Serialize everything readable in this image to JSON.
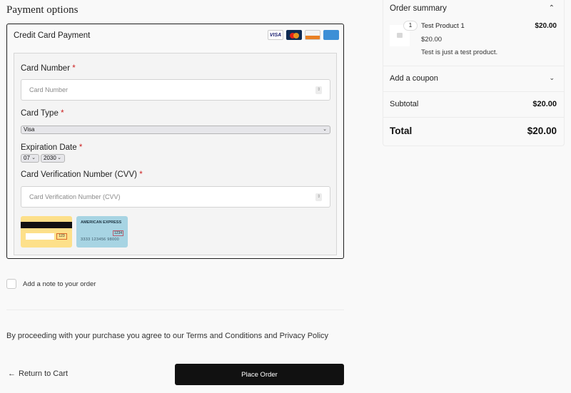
{
  "payment": {
    "section_title": "Payment options",
    "method_label": "Credit Card Payment",
    "card_logos": [
      {
        "name": "visa",
        "text": "VISA"
      },
      {
        "name": "mastercard",
        "text": ""
      },
      {
        "name": "discover",
        "text": "DISCOVER"
      },
      {
        "name": "amex",
        "text": "AMERICAN EXPRESS"
      }
    ],
    "fields": {
      "card_number": {
        "label": "Card Number",
        "required": "*",
        "placeholder": "Card Number"
      },
      "card_type": {
        "label": "Card Type",
        "required": "*",
        "selected": "Visa"
      },
      "expiration": {
        "label": "Expiration Date",
        "required": "*",
        "month": "07",
        "year": "2030"
      },
      "cvv": {
        "label": "Card Verification Number (CVV)",
        "required": "*",
        "placeholder": "Card Verification Number (CVV)"
      }
    },
    "cvv_examples": {
      "visa_cvv": "123",
      "amex_title": "AMERICAN EXPRESS",
      "amex_cvv": "1234",
      "amex_number": "3333 123456 98000"
    }
  },
  "note": {
    "label": "Add a note to your order",
    "checked": false
  },
  "terms_text": "By proceeding with your purchase you agree to our Terms and Conditions and Privacy Policy",
  "actions": {
    "return_label": "Return to Cart",
    "return_icon": "arrow-left-icon",
    "place_order_label": "Place Order"
  },
  "summary": {
    "title": "Order summary",
    "items": [
      {
        "quantity": "1",
        "name": "Test Product 1",
        "price": "$20.00",
        "line_total": "$20.00",
        "description": "Test is just a test product."
      }
    ],
    "coupon_label": "Add a coupon",
    "subtotal_label": "Subtotal",
    "subtotal_value": "$20.00",
    "total_label": "Total",
    "total_value": "$20.00"
  }
}
